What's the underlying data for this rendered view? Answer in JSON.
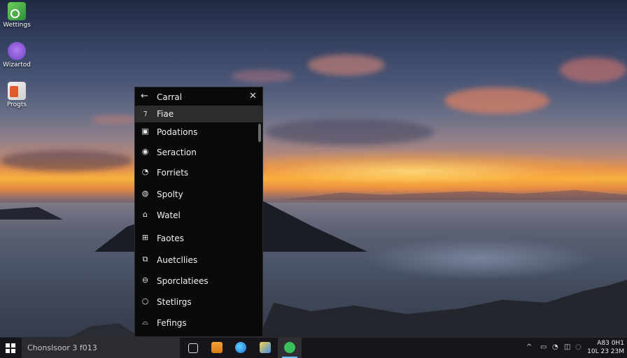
{
  "desktop": {
    "icons": [
      {
        "label": "Wettings",
        "icon": "settings-app-icon"
      },
      {
        "label": "Wizartod",
        "icon": "wizard-app-icon"
      },
      {
        "label": "Progts",
        "icon": "programs-app-icon"
      }
    ]
  },
  "flyout": {
    "title": "Carral",
    "back_icon": "←",
    "close_icon": "✕",
    "items": [
      {
        "label": "Fiae",
        "icon": "⁊"
      },
      {
        "label": "Podations",
        "icon": "▣"
      },
      {
        "label": "Seraction",
        "icon": "◉"
      },
      {
        "label": "Forriets",
        "icon": "◔"
      },
      {
        "label": "Spolty",
        "icon": "◍"
      },
      {
        "label": "Watel",
        "icon": "⌂"
      },
      {
        "label": "Faotes",
        "icon": "⊞"
      },
      {
        "label": "Auetcllies",
        "icon": "⧉"
      },
      {
        "label": "Sporclatiees",
        "icon": "⊖"
      },
      {
        "label": "Stetlirgs",
        "icon": "○"
      },
      {
        "label": "Fefings",
        "icon": "⌓"
      }
    ]
  },
  "taskbar": {
    "search_text": "Chonslsoor 3 f013",
    "clock_line1": "A83 0H1",
    "clock_line2": "10L 23 23M",
    "tray": [
      "^",
      "▭",
      "◔",
      "◫",
      "◌"
    ],
    "accent": "#6cc3ff"
  }
}
